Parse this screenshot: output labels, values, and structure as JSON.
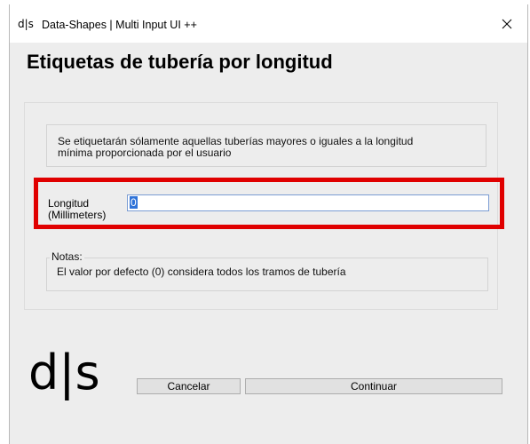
{
  "window": {
    "app_icon": "d|s",
    "title": "Data-Shapes | Multi Input UI ++",
    "close_icon": "close-icon"
  },
  "main": {
    "heading": "Etiquetas de tubería por longitud",
    "description_line1": "Se etiquetarán sólamente aquellas tuberías mayores o iguales a la longitud",
    "description_line2": "mínima proporcionada por el usuario",
    "field": {
      "label_line1": "Longitud",
      "label_line2": "(Millimeters)",
      "value": "0"
    },
    "notes": {
      "legend": "Notas:",
      "text": "El valor por defecto (0) considera todos los tramos de tubería"
    }
  },
  "footer": {
    "logo": "d|s",
    "cancel_label": "Cancelar",
    "continue_label": "Continuar"
  },
  "colors": {
    "highlight": "#e00000",
    "selection": "#2f73d8",
    "window_bg": "#ededed"
  }
}
